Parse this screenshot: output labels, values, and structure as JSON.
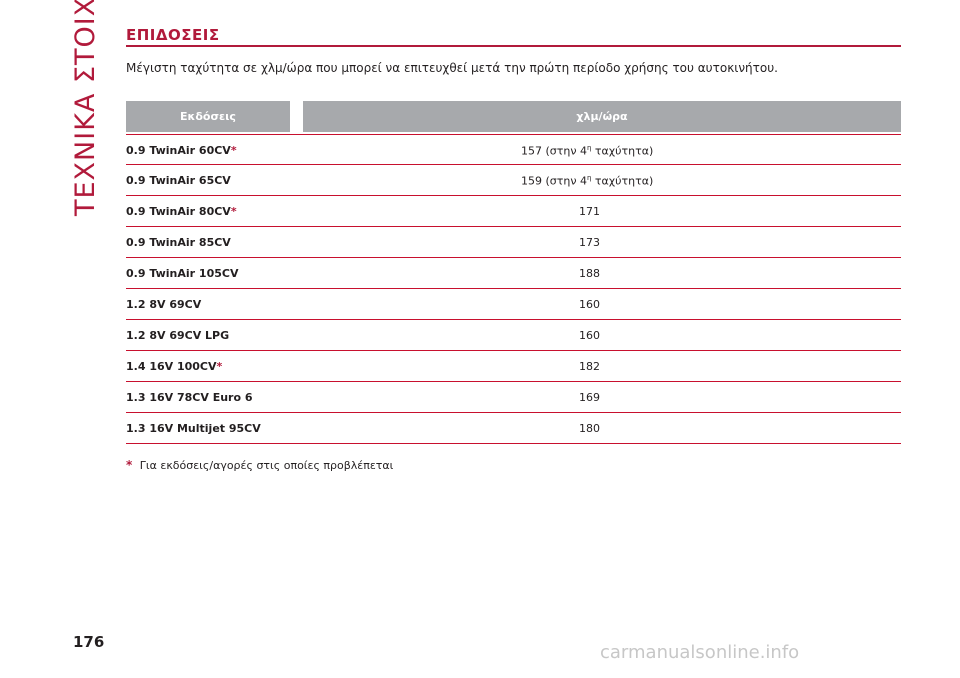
{
  "side_title": "ΤΕΧΝΙΚΑ ΣΤΟΙΧΕΙΑ",
  "section_title": "ΕΠΙΔΟΣΕΙΣ",
  "intro": "Μέγιστη ταχύτητα σε χλμ/ώρα που μπορεί να επιτευχθεί μετά την πρώτη περίοδο χρήσης του αυτοκινήτου.",
  "table": {
    "headers": [
      "Εκδόσεις",
      "χλμ/ώρα"
    ],
    "rows": [
      {
        "version": "0.9 TwinAir 60CV",
        "star": "*",
        "speed": "157 (στην 4",
        "sup": "η",
        "speed_suffix": " ταχύτητα)"
      },
      {
        "version": "0.9 TwinAir 65CV",
        "star": "",
        "speed": "159 (στην 4",
        "sup": "η",
        "speed_suffix": " ταχύτητα)"
      },
      {
        "version": "0.9 TwinAir 80CV",
        "star": "*",
        "speed": "171",
        "sup": "",
        "speed_suffix": ""
      },
      {
        "version": "0.9 TwinAir 85CV",
        "star": "",
        "speed": "173",
        "sup": "",
        "speed_suffix": ""
      },
      {
        "version": "0.9 TwinAir 105CV",
        "star": "",
        "speed": "188",
        "sup": "",
        "speed_suffix": ""
      },
      {
        "version": "1.2 8V 69CV",
        "star": "",
        "speed": "160",
        "sup": "",
        "speed_suffix": ""
      },
      {
        "version": "1.2 8V 69CV LPG",
        "star": "",
        "speed": "160",
        "sup": "",
        "speed_suffix": ""
      },
      {
        "version": "1.4 16V 100CV",
        "star": "*",
        "speed": "182",
        "sup": "",
        "speed_suffix": ""
      },
      {
        "version": "1.3 16V 78CV Euro 6",
        "star": "",
        "speed": "169",
        "sup": "",
        "speed_suffix": ""
      },
      {
        "version": "1.3 16V Multijet 95CV",
        "star": "",
        "speed": "180",
        "sup": "",
        "speed_suffix": ""
      }
    ]
  },
  "footnote": {
    "star": "*",
    "text": "Για εκδόσεις/αγορές στις οποίες προβλέπεται"
  },
  "page_number": "176",
  "watermark": "carmanualsonline.info",
  "colors": {
    "accent": "#b11a3b",
    "header_bg": "#a7a9ac",
    "rule": "#c8102e"
  }
}
